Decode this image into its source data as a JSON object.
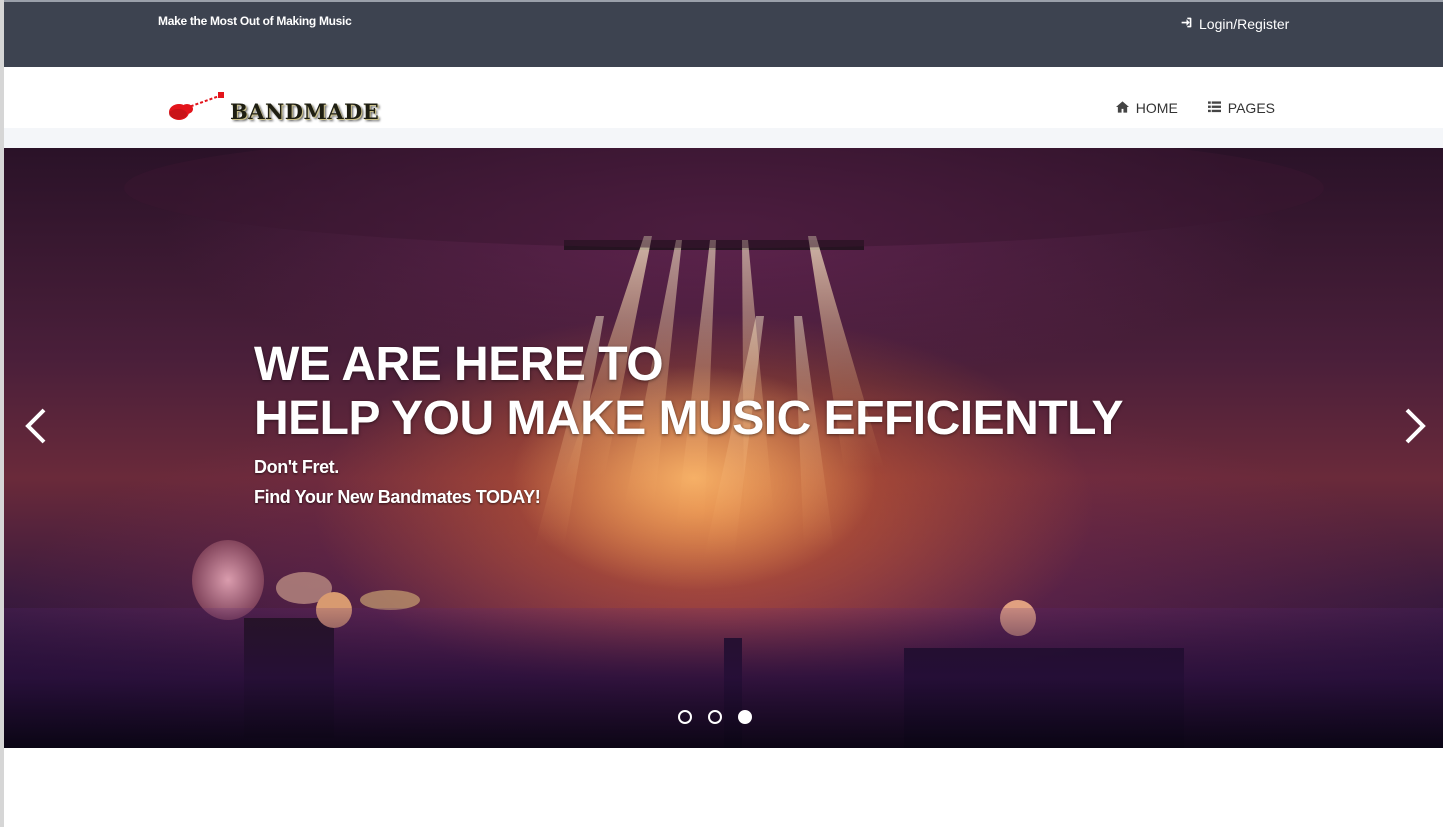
{
  "topbar": {
    "tagline": "Make the Most Out of Making Music",
    "login_label": "Login/Register",
    "login_icon": "sign-in-icon"
  },
  "navbar": {
    "logo_text": "BANDMADE",
    "logo_icon": "guitar-icon",
    "items": [
      {
        "label": "HOME",
        "icon": "home-icon"
      },
      {
        "label": "PAGES",
        "icon": "list-icon"
      }
    ]
  },
  "hero": {
    "title_line1": "WE ARE HERE TO",
    "title_line2": "HELP YOU MAKE MUSIC EFFICIENTLY",
    "sub_line1": "Don't Fret.",
    "sub_line2": "Find Your New Bandmates TODAY!",
    "slides_total": 3,
    "active_slide": 3
  },
  "colors": {
    "topbar_bg": "#3d4350",
    "text_light": "#ffffff",
    "nav_text": "#333333",
    "logo_guitar": "#e3141b"
  }
}
